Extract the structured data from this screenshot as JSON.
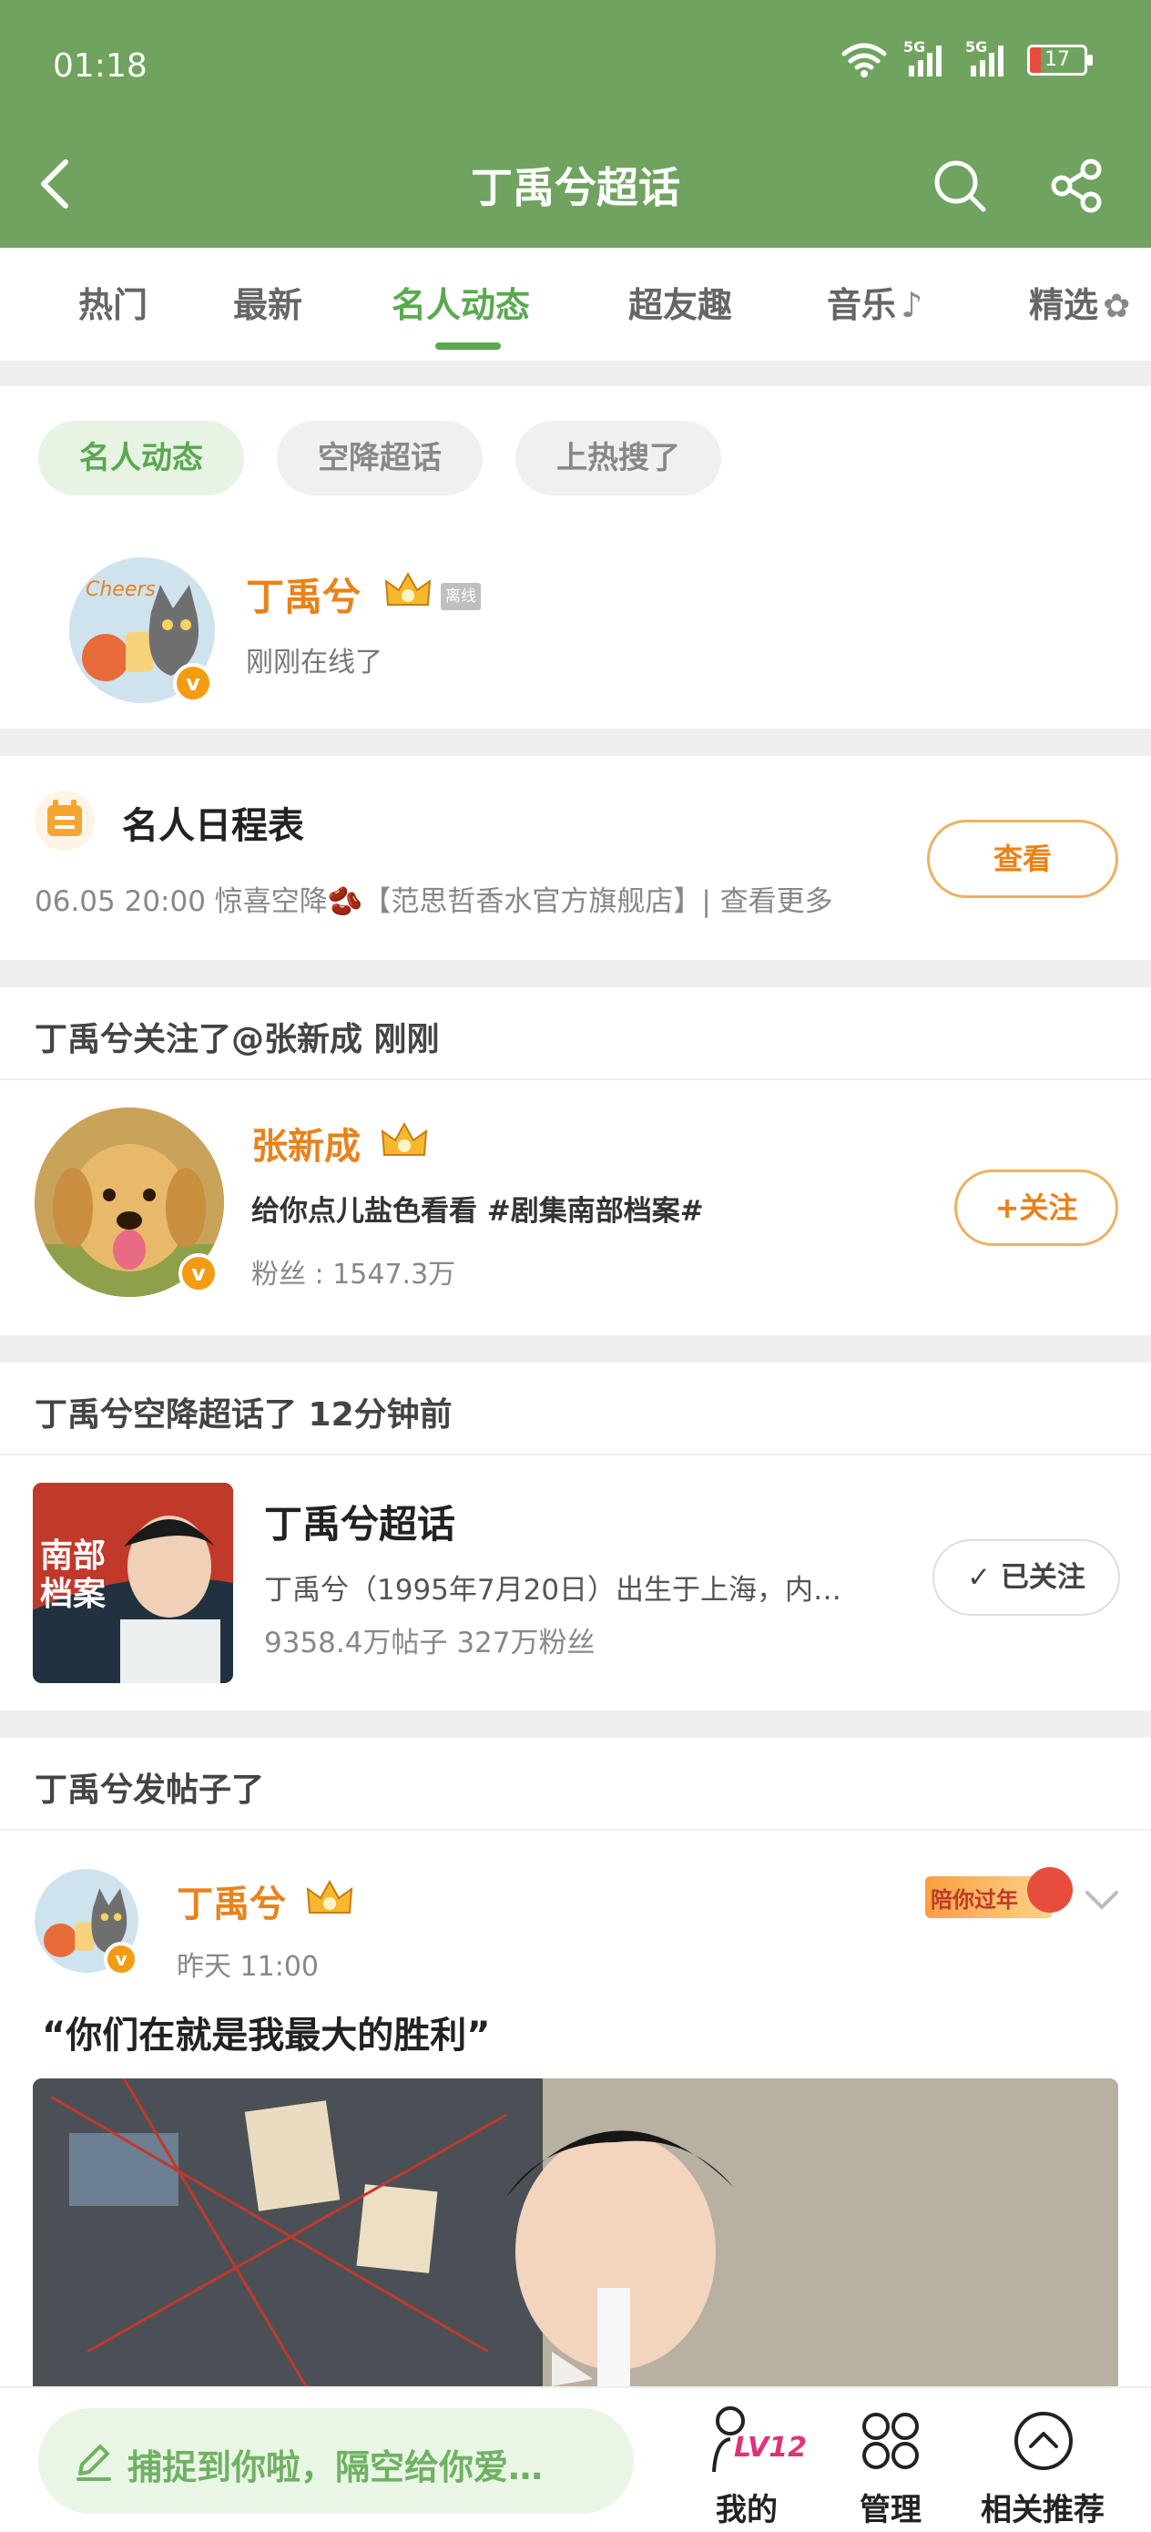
{
  "status": {
    "time": "01:18",
    "battery": "17",
    "signal1": "5G",
    "signal2": "5G"
  },
  "nav": {
    "title": "丁禹兮超话"
  },
  "tabs": [
    {
      "label": "热门"
    },
    {
      "label": "最新"
    },
    {
      "label": "名人动态"
    },
    {
      "label": "超友趣"
    },
    {
      "label": "音乐"
    },
    {
      "label": "精选"
    }
  ],
  "chips": [
    {
      "label": "名人动态"
    },
    {
      "label": "空降超话"
    },
    {
      "label": "上热搜了"
    }
  ],
  "online_user": {
    "name": "丁禹兮",
    "status_badge": "离线",
    "status_text": "刚刚在线了"
  },
  "schedule": {
    "title": "名人日程表",
    "detail": "06.05 20:00 惊喜空降🫘【范思哲香水官方旗舰店】| 查看更多",
    "view_button": "查看"
  },
  "follow_activity": {
    "header": "丁禹兮关注了@张新成 刚刚",
    "name": "张新成",
    "bio": "给你点儿盐色看看 #剧集南部档案#",
    "fans_label": "粉丝",
    "fans_value": "1547.3万",
    "follow_button": "+关注"
  },
  "topic_activity": {
    "header": "丁禹兮空降超话了 12分钟前",
    "title": "丁禹兮超话",
    "desc": "丁禹兮（1995年7月20日）出生于上海，内…",
    "stats": "9358.4万帖子  327万粉丝",
    "followed_button": "已关注",
    "poster_text": "南部档案"
  },
  "post": {
    "header": "丁禹兮发帖子了",
    "author": "丁禹兮",
    "time": "昨天 11:00",
    "badge": "陪你过年",
    "content": "“你们在就是我最大的胜利”"
  },
  "bottom_bar": {
    "compose_placeholder": "捕捉到你啦，隔空给你爱…",
    "mine_label": "我的",
    "level": "LV12",
    "manage_label": "管理",
    "recommend_label": "相关推荐"
  },
  "colors": {
    "brand_green": "#6fa35f",
    "accent_green": "#5aa84f",
    "orange": "#e8821a"
  }
}
